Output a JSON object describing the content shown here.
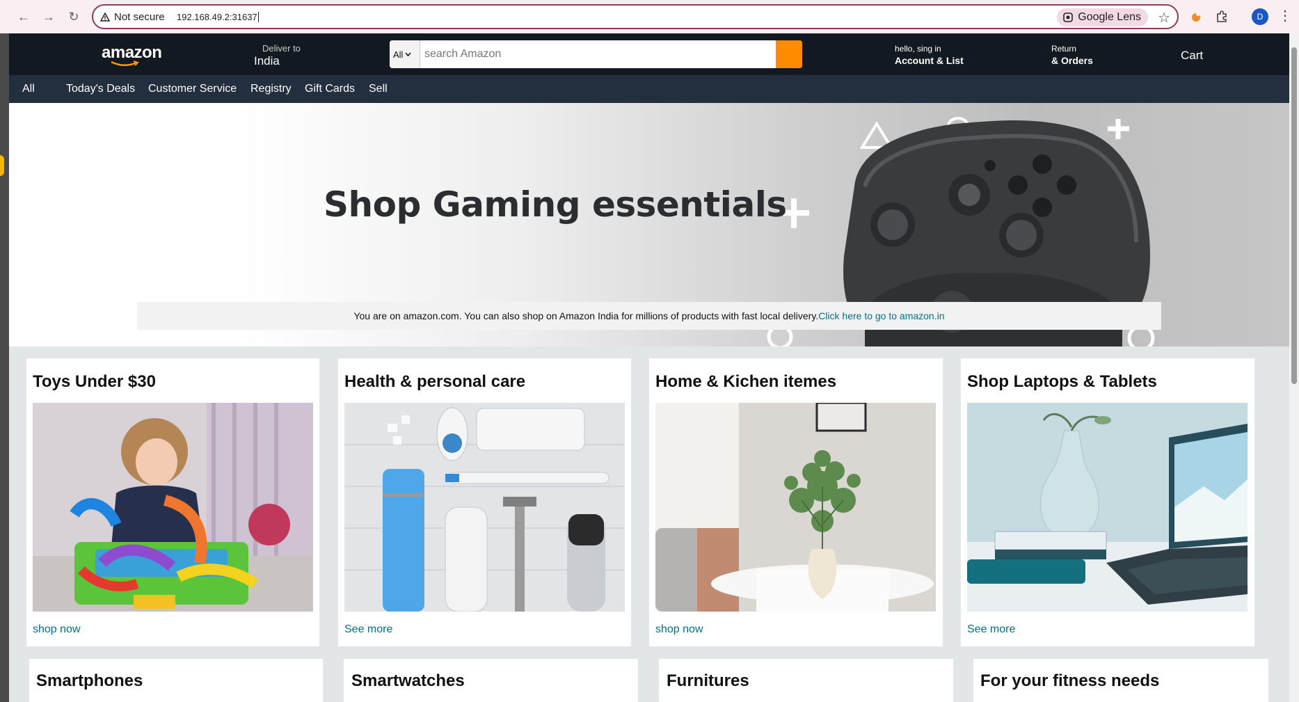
{
  "browser": {
    "security_label": "Not secure",
    "url": "192.168.49.2:31637",
    "lens_label": "Google Lens",
    "profile_initial": "D"
  },
  "header": {
    "logo": "amazon",
    "deliver_to_label": "Deliver to",
    "deliver_to_location": "India",
    "search_category": "All",
    "search_placeholder": "search Amazon",
    "account_line1": "hello, sing in",
    "account_line2": "Account & List",
    "returns_line1": "Return",
    "returns_line2": "& Orders",
    "cart_label": "Cart",
    "accent_color": "#ff8c00",
    "bar_color": "#131921"
  },
  "subnav": {
    "items": [
      "All",
      "Today's Deals",
      "Customer Service",
      "Registry",
      "Gift Cards",
      "Sell"
    ],
    "bar_color": "#232f3e"
  },
  "hero": {
    "title": "Shop Gaming essentials",
    "notice_text": "You are on amazon.com. You can also shop on Amazon India for millions of products with fast local delivery.",
    "notice_link": "Click here to go to amazon.in"
  },
  "cards_row1": [
    {
      "title": "Toys Under $30",
      "link": "shop now"
    },
    {
      "title": "Health & personal care",
      "link": "See more"
    },
    {
      "title": "Home & Kichen itemes",
      "link": "shop now"
    },
    {
      "title": "Shop Laptops & Tablets",
      "link": "See more"
    }
  ],
  "cards_row2": [
    {
      "title": "Smartphones"
    },
    {
      "title": "Smartwatches"
    },
    {
      "title": "Furnitures"
    },
    {
      "title": "For your fitness needs"
    }
  ],
  "link_color": "#007185"
}
